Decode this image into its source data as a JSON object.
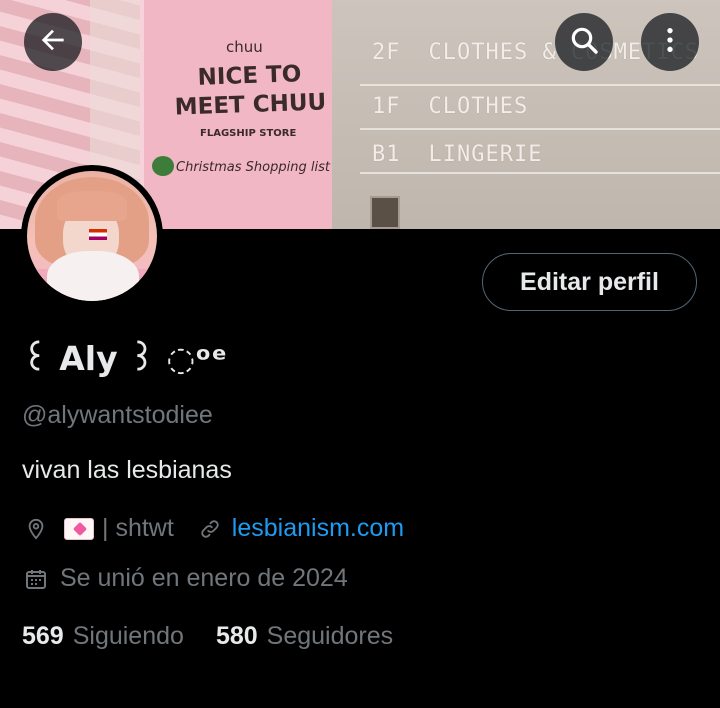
{
  "header": {
    "banner_text": {
      "brand": "chuu",
      "headline_line1": "NICE TO",
      "headline_line2": "MEET CHUU",
      "subtitle": "FLAGSHIP STORE",
      "list": "Christmas Shopping list",
      "floors": [
        {
          "level": "2F",
          "label": "CLOTHES & COSMETICS"
        },
        {
          "level": "1F",
          "label": "CLOTHES"
        },
        {
          "level": "B1",
          "label": "LINGERIE"
        }
      ]
    },
    "icons": {
      "back": "arrow-left-icon",
      "search": "search-icon",
      "more": "more-vertical-icon"
    }
  },
  "profile": {
    "display_name": "꒰ Aly ꒱ ◌ᵒᵉ",
    "handle": "@alywantstodiee",
    "bio": "vivan las lesbianas",
    "location": "| shtwt",
    "website": "lesbianism.com",
    "joined": "Se unió en enero de 2024",
    "edit_button": "Editar perfil",
    "following_count": "569",
    "following_label": "Siguiendo",
    "followers_count": "580",
    "followers_label": "Seguidores"
  },
  "colors": {
    "background": "#000000",
    "text_primary": "#e7e9ea",
    "text_secondary": "#71767b",
    "link": "#1d9bf0",
    "border": "#536471"
  }
}
